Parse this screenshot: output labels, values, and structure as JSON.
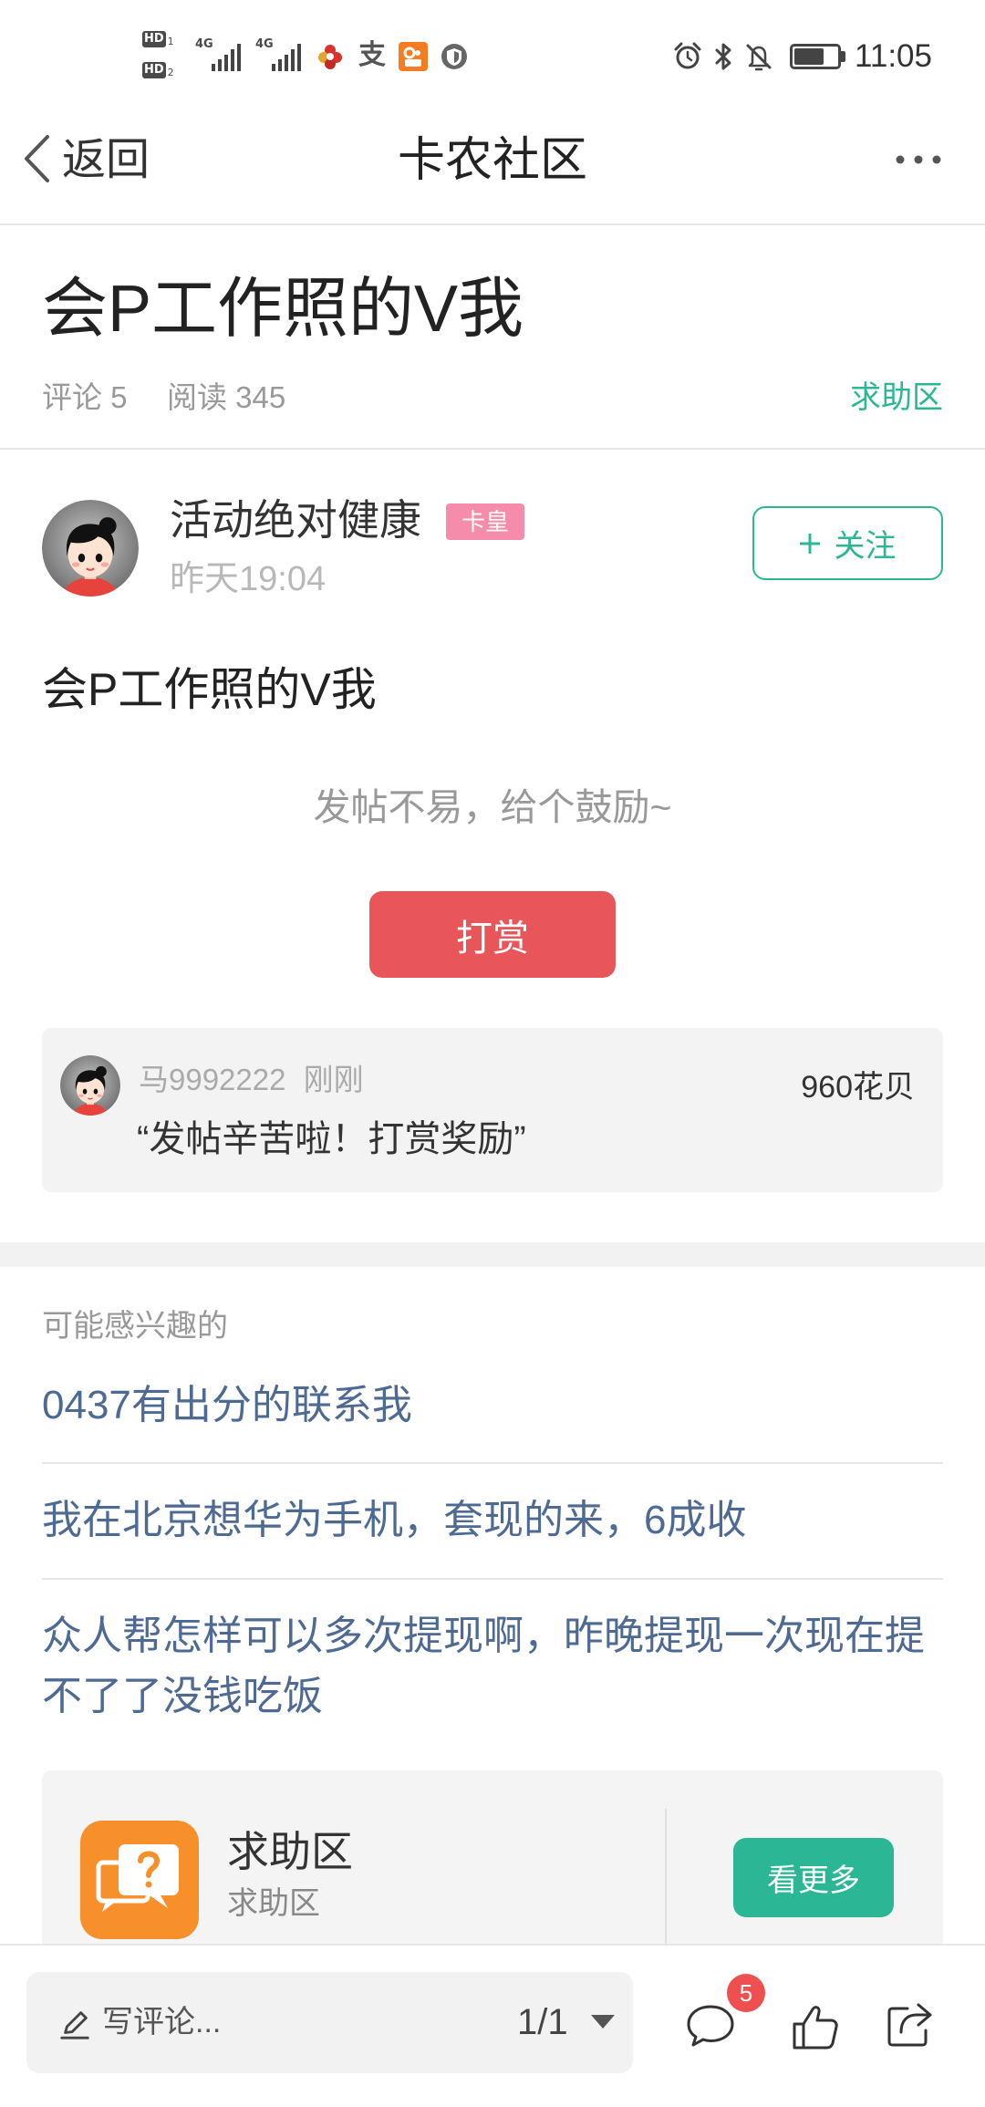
{
  "status_bar": {
    "sim_label": "HD",
    "sim1_index": "1",
    "sim2_index": "2",
    "network1": "4G",
    "network2": "4G",
    "alipay_glyph": "支",
    "battery_level": 0.7,
    "time": "11:05",
    "icons": [
      "signal-icon",
      "flower-app-icon",
      "alipay-icon",
      "orange-app-icon",
      "shield-app-icon",
      "alarm-icon",
      "bluetooth-icon",
      "bell-off-icon",
      "battery-icon"
    ]
  },
  "nav": {
    "back_label": "返回",
    "title": "卡农社区",
    "icons": [
      "back-chevron-icon",
      "more-dots-icon"
    ]
  },
  "post": {
    "title": "会P工作照的V我",
    "comments": "评论 5",
    "reads": "阅读 345",
    "category": "求助区",
    "author": {
      "name": "活动绝对健康",
      "badge": "卡皇",
      "time": "昨天19:04"
    },
    "follow_label": "关注",
    "body": "会P工作照的V我"
  },
  "reward": {
    "prompt": "发帖不易，给个鼓励~",
    "button_label": "打赏",
    "record": {
      "user": "马9992222",
      "time": "刚刚",
      "amount": "960花贝",
      "message": "“发帖辛苦啦！打赏奖励”"
    }
  },
  "related": {
    "header": "可能感兴趣的",
    "items": [
      "0437有出分的联系我",
      "我在北京想华为手机，套现的来，6成收",
      "众人帮怎样可以多次提现啊，昨晚提现一次现在提不了了没钱吃饭"
    ]
  },
  "forum_card": {
    "title": "求助区",
    "subtitle": "求助区",
    "button_label": "看更多",
    "icon": "help-forum-icon"
  },
  "bottom_bar": {
    "comment_placeholder": "写评论...",
    "page_indicator": "1/1",
    "comment_count": "5",
    "icons": [
      "pencil-icon",
      "dropdown-triangle-icon",
      "comment-icon",
      "like-icon",
      "share-icon"
    ]
  },
  "colors": {
    "accent": "#2bb795",
    "reward": "#e8565a",
    "badge": "#f58cab",
    "link": "#4e6a93",
    "dot": "#ef4f4f"
  }
}
